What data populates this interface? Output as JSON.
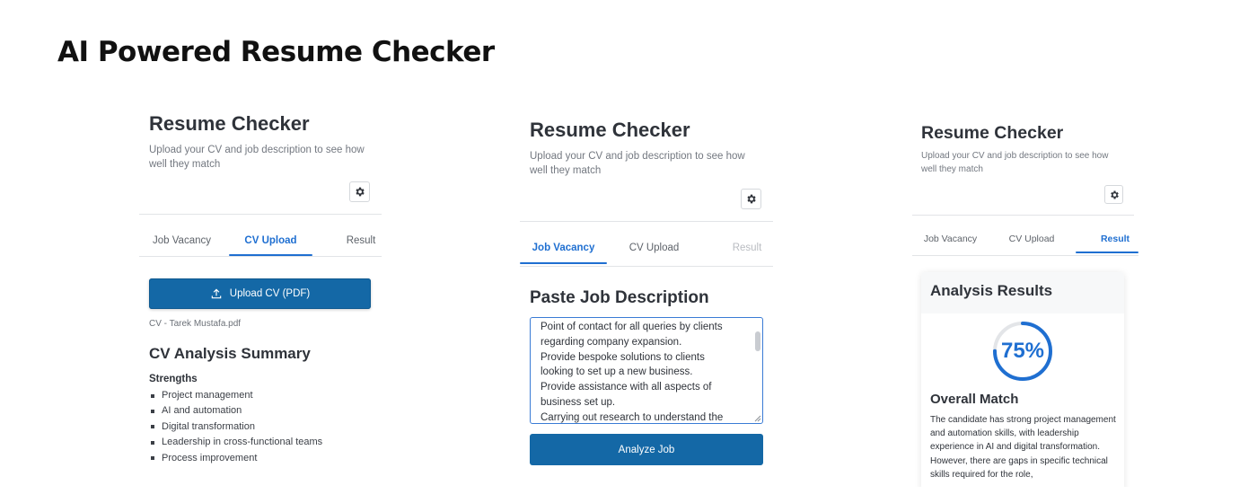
{
  "headline": "AI Powered Resume Checker",
  "app": {
    "title": "Resume Checker",
    "subtitle": "Upload your CV and job description to see how well they match",
    "tabs": [
      "Job Vacancy",
      "CV Upload",
      "Result"
    ]
  },
  "panel1": {
    "active_tab": "CV Upload",
    "upload_button": "Upload CV (PDF)",
    "file_name": "CV - Tarek Mustafa.pdf",
    "summary_heading": "CV Analysis Summary",
    "strengths_heading": "Strengths",
    "strengths": [
      "Project management",
      "AI and automation",
      "Digital transformation",
      "Leadership in cross-functional teams",
      "Process improvement"
    ]
  },
  "panel2": {
    "active_tab": "Job Vacancy",
    "disabled_tab": "Result",
    "section_heading": "Paste Job Description",
    "job_description_lines": [
      "Point of contact for all queries by clients",
      "regarding company expansion.",
      "Provide bespoke solutions to clients",
      "looking to set up a new business.",
      "Provide assistance with all aspects of",
      "business set up.",
      "Carrying out research to understand the"
    ],
    "analyze_button": "Analyze Job"
  },
  "panel3": {
    "active_tab": "Result",
    "card_heading": "Analysis Results",
    "match_percent": 75,
    "match_label": "75%",
    "overall_heading": "Overall Match",
    "overall_text": "The candidate has strong project management and automation skills, with leadership experience in AI and digital transformation. However, there are gaps in specific technical skills required for the role,"
  },
  "icons": {
    "settings": "gear-icon",
    "upload": "upload-icon"
  },
  "colors": {
    "accent": "#1f6fd1",
    "primary_button": "#1468a6",
    "progress_track": "#e3e5e8"
  }
}
